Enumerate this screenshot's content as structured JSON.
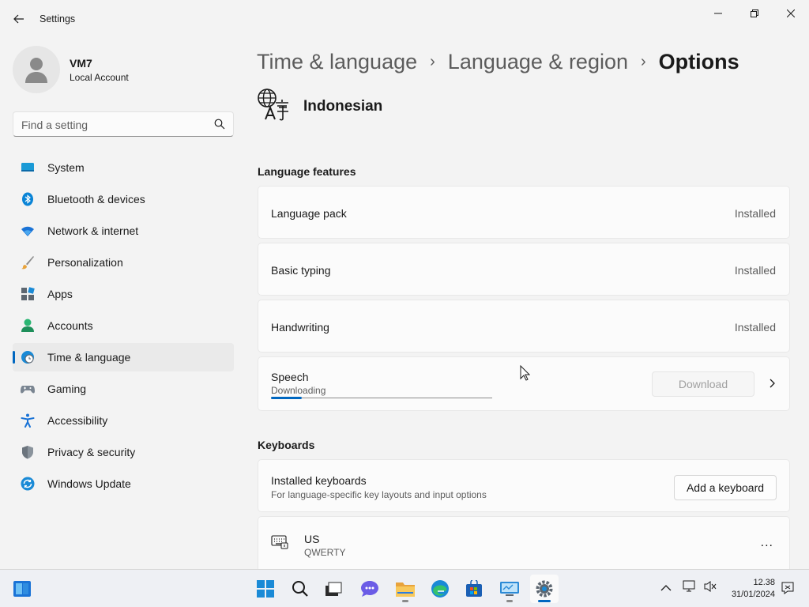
{
  "window": {
    "app_title": "Settings",
    "back_icon": "back-arrow-icon",
    "controls": [
      "minimize-icon",
      "restore-icon",
      "close-icon"
    ]
  },
  "profile": {
    "name": "VM7",
    "account_type": "Local Account"
  },
  "search": {
    "placeholder": "Find a setting",
    "icon": "search-icon"
  },
  "sidebar": {
    "items": [
      {
        "label": "System",
        "icon": "system-icon"
      },
      {
        "label": "Bluetooth & devices",
        "icon": "bluetooth-icon"
      },
      {
        "label": "Network & internet",
        "icon": "wifi-icon"
      },
      {
        "label": "Personalization",
        "icon": "brush-icon"
      },
      {
        "label": "Apps",
        "icon": "apps-icon"
      },
      {
        "label": "Accounts",
        "icon": "accounts-icon"
      },
      {
        "label": "Time & language",
        "icon": "time-language-icon",
        "active": true
      },
      {
        "label": "Gaming",
        "icon": "gamepad-icon"
      },
      {
        "label": "Accessibility",
        "icon": "accessibility-icon"
      },
      {
        "label": "Privacy & security",
        "icon": "shield-icon"
      },
      {
        "label": "Windows Update",
        "icon": "update-icon"
      }
    ]
  },
  "breadcrumb": {
    "items": [
      "Time & language",
      "Language & region",
      "Options"
    ],
    "separator_icon": "chevron-right-icon"
  },
  "language": {
    "name": "Indonesian",
    "icon": "language-icon"
  },
  "language_features": {
    "title": "Language features",
    "items": [
      {
        "label": "Language pack",
        "status": "Installed"
      },
      {
        "label": "Basic typing",
        "status": "Installed"
      },
      {
        "label": "Handwriting",
        "status": "Installed"
      }
    ],
    "speech": {
      "label": "Speech",
      "status": "Downloading",
      "progress": 0.14,
      "download_label": "Download"
    }
  },
  "keyboards": {
    "title": "Keyboards",
    "installed_label": "Installed keyboards",
    "installed_desc": "For language-specific key layouts and input options",
    "add_label": "Add a keyboard",
    "items": [
      {
        "name": "US",
        "layout": "QWERTY",
        "icon": "keyboard-icon",
        "more": "..."
      }
    ]
  },
  "taskbar": {
    "apps": [
      "widgets-icon",
      "start-icon",
      "search-icon",
      "task-view-icon",
      "chat-icon",
      "file-explorer-icon",
      "edge-icon",
      "store-icon",
      "remote-desktop-icon",
      "settings-icon"
    ],
    "tray": {
      "time": "12.38",
      "date": "31/01/2024"
    }
  },
  "colors": {
    "accent": "#0067c0",
    "background": "#f3f3f3",
    "card": "#fbfbfb"
  }
}
